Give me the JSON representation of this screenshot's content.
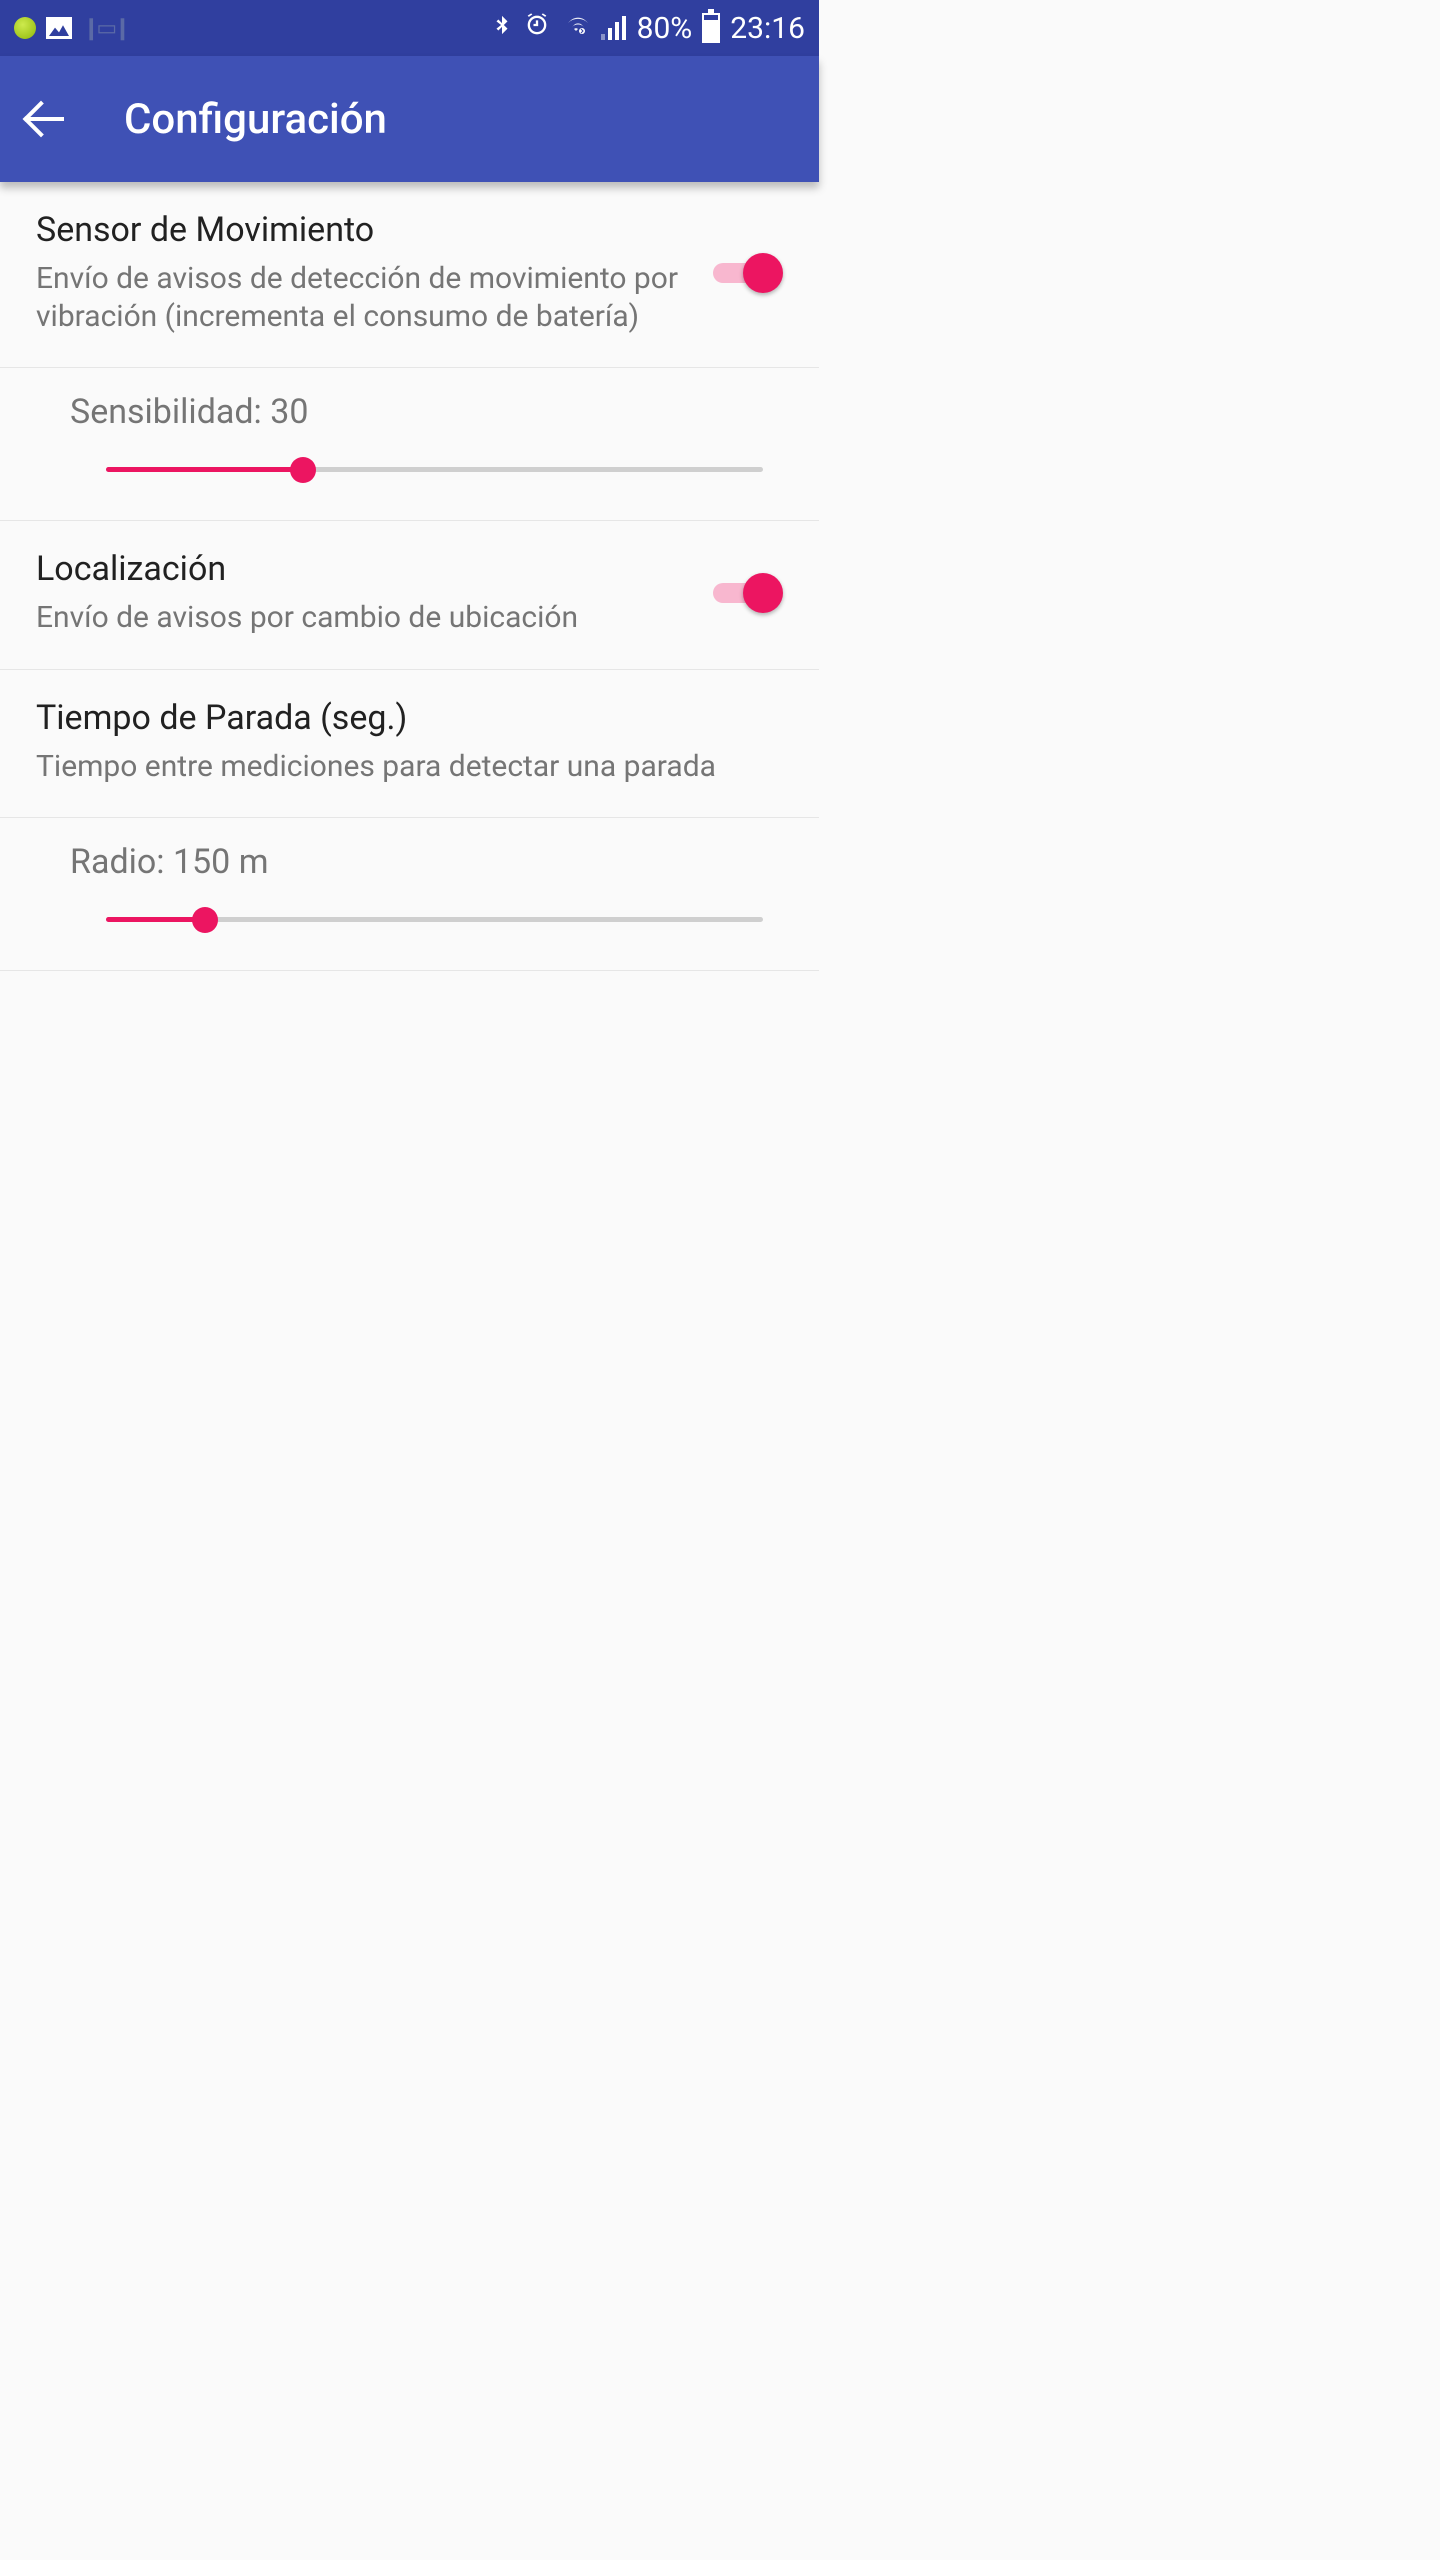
{
  "statusbar": {
    "battery_pct": "80%",
    "time": "23:16"
  },
  "appbar": {
    "title": "Configuración"
  },
  "settings": {
    "motion": {
      "title": "Sensor de Movimiento",
      "desc": "Envío de avisos de detección de movimiento por vibración (incrementa el consumo de batería)",
      "enabled": true
    },
    "sensitivity": {
      "label": "Sensibilidad: 30",
      "value": 30
    },
    "location": {
      "title": "Localización",
      "desc": "Envío de avisos por cambio de ubicación",
      "enabled": true
    },
    "stoptime": {
      "title": "Tiempo de Parada (seg.)",
      "desc": "Tiempo entre mediciones para detectar una parada"
    },
    "radius": {
      "label": "Radio: 150 m",
      "value": 150
    }
  }
}
